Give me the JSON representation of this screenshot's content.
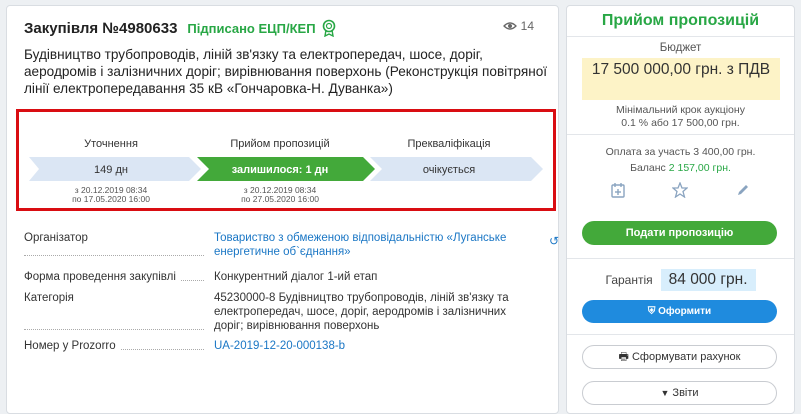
{
  "header": {
    "title": "Закупівля №4980633",
    "signed_label": "Підписано ЕЦП/КЕП",
    "views_count": "14"
  },
  "description": "Будівництво трубопроводів, ліній зв'язку та електропередач, шосе, доріг, аеродромів і залізничних доріг; вирівнювання поверхонь (Реконструкція повітряної лінії електропередавання 35 кВ «Гончаровка-Н. Дуванка»)",
  "timeline": {
    "stages": [
      {
        "label": "Уточнення",
        "status": "149 дн",
        "date_from": "з 20.12.2019 08:34",
        "date_to": "по 17.05.2020 16:00"
      },
      {
        "label": "Прийом пропозицій",
        "status": "залишилося: 1 дн",
        "date_from": "з 20.12.2019 08:34",
        "date_to": "по 27.05.2020 16:00"
      },
      {
        "label": "Прекваліфікація",
        "status": "очікується",
        "date_from": "",
        "date_to": ""
      }
    ],
    "colors": {
      "done": "#dbe6f4",
      "active": "#43a93a",
      "pending": "#dbe6f4"
    }
  },
  "details": {
    "organizer_label": "Організатор",
    "organizer_value": "Товариство з обмеженою відповідальністю «Луганське енергетичне об`єднання»",
    "form_label": "Форма проведення закупівлі",
    "form_value": "Конкурентний діалог 1-ий етап",
    "category_label": "Категорія",
    "category_value": "45230000-8 Будівництво трубопроводів, ліній зв'язку та електропередач, шосе, доріг, аеродромів і залізничних доріг; вирівнювання поверхонь",
    "prozorro_label": "Номер у Prozorro",
    "prozorro_value": "UA-2019-12-20-000138-b"
  },
  "sidebar": {
    "title": "Прийом пропозицій",
    "budget_label": "Бюджет",
    "budget_value": "17 500 000,00 грн. з ПДВ",
    "min_step_label": "Мінімальний крок аукціону",
    "min_step_value": "0.1 % або 17 500,00 грн.",
    "participation_fee": "Оплата за участь 3 400,00 грн.",
    "balance_label": "Баланс",
    "balance_value": "2 157,00 грн.",
    "submit_button": "Подати пропозицію",
    "guarantee_label": "Гарантія",
    "guarantee_value": "84 000 грн.",
    "issue_button": "Оформити",
    "invoice_button": "Сформувати рахунок",
    "reports_button": "Звіти"
  }
}
